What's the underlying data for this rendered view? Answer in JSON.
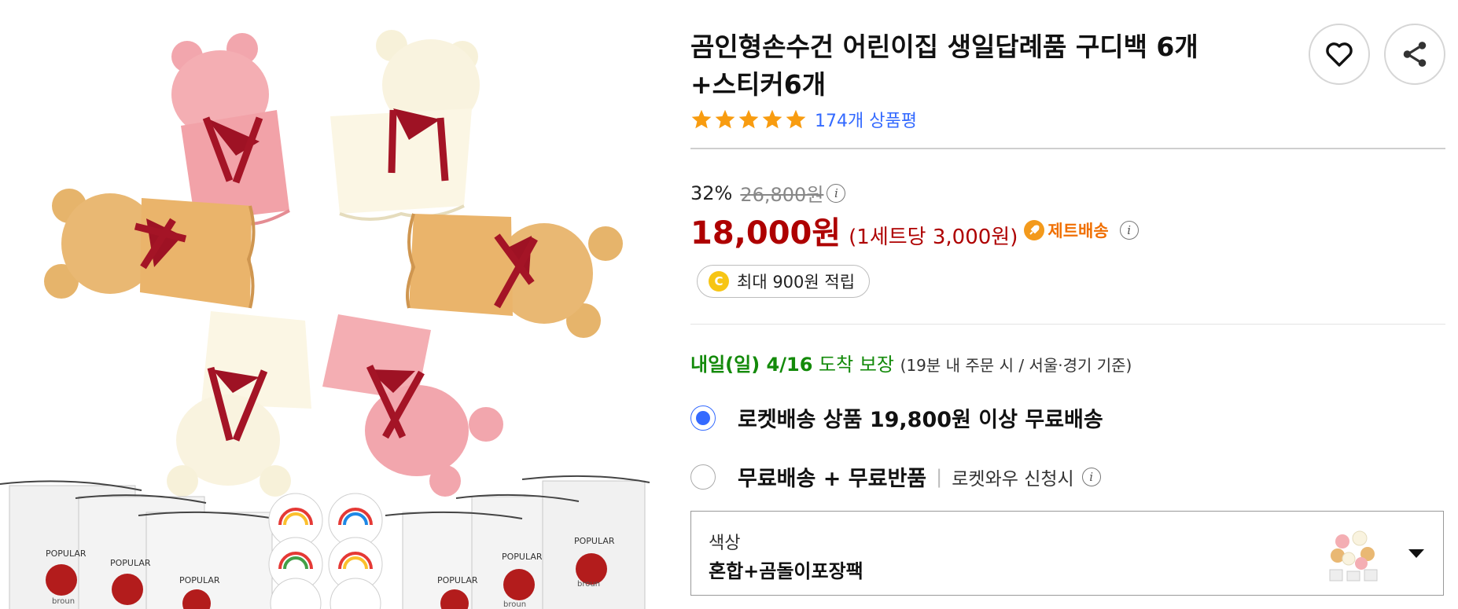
{
  "product": {
    "title_line1": "곰인형손수건 어린이집 생일답례품 구디백 6개",
    "title_line2": "+스티커6개",
    "review_count_text": "174개 상품평",
    "rating_stars": 5
  },
  "pricing": {
    "discount_rate": "32%",
    "original_price": "26,800원",
    "sale_price": "18,000원",
    "unit_price": "(1세트당 3,000원)",
    "delivery_badge": "제트배송",
    "reward": "최대 900원 적립",
    "reward_coin_letter": "C"
  },
  "delivery": {
    "date": "내일(일) 4/16",
    "guarantee": "도착 보장",
    "condition": "(19분  내 주문 시 / 서울·경기 기준)"
  },
  "shipping_options": [
    {
      "label": "로켓배송 상품 19,800원 이상 무료배송",
      "selected": true
    },
    {
      "label": "무료배송 + 무료반품",
      "sub": "로켓와우 신청시",
      "selected": false
    }
  ],
  "option_select": {
    "label": "색상",
    "value": "혼합+곰돌이포장팩"
  },
  "image_text": {
    "bag_brand": "POPULAR",
    "bag_sub": "broun"
  },
  "icons": {
    "wishlist": "heart-icon",
    "share": "share-icon",
    "info": "info-icon",
    "jet": "rocket-icon",
    "dropdown": "caret-down-icon"
  },
  "colors": {
    "sale_red": "#ae0000",
    "link_blue": "#346aff",
    "arrival_green": "#138a0a",
    "star_orange": "#f89c10",
    "jet_orange": "#f06f00"
  }
}
